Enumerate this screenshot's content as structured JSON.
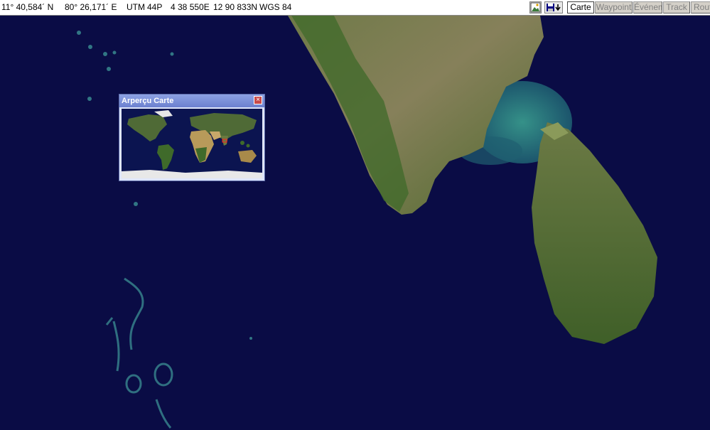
{
  "status": {
    "latitude": "11° 40,584´ N",
    "longitude": "80° 26,171´ E",
    "utm_label": "UTM",
    "utm_zone": "44P",
    "easting": "4 38 550E",
    "northing": "12 90 833N",
    "datum": "WGS 84"
  },
  "toolbar": {
    "icons": [
      "map-picture-icon",
      "save-download-icon"
    ],
    "buttons": [
      "Carte",
      "Waypoint",
      "Événements",
      "Track",
      "Route"
    ],
    "active_button": "Carte"
  },
  "overview": {
    "title": "Arperçu Carte",
    "close_glyph": "×"
  },
  "colors": {
    "ocean": "#0a0c45",
    "land": "#4d6b2f",
    "shallow": "#2a8a80",
    "window_title": "#7a8fd8",
    "marker": "#ff2020"
  }
}
